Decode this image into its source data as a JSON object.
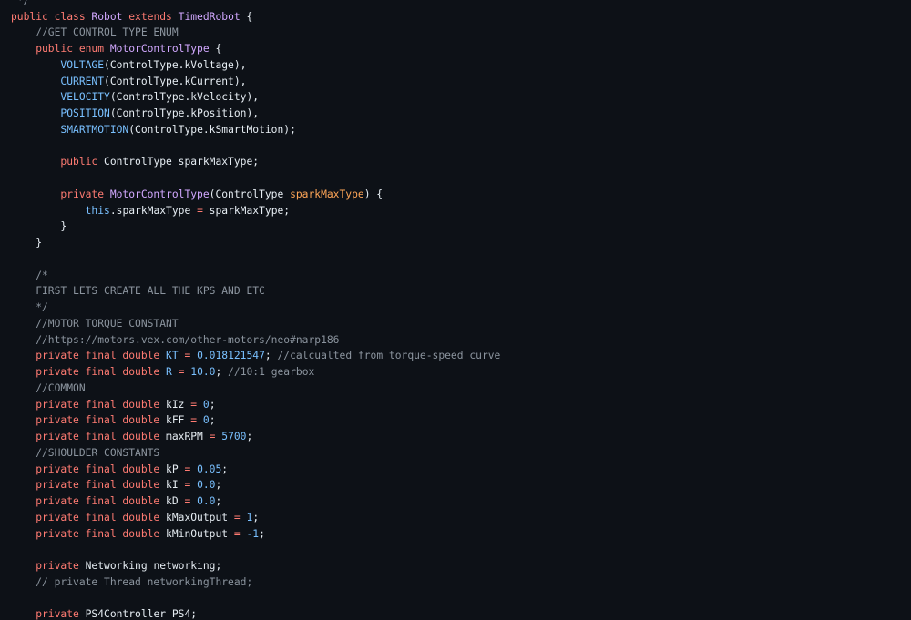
{
  "code": {
    "lines": [
      [
        [
          "cm",
          " */"
        ]
      ],
      [
        [
          "kw",
          "public class "
        ],
        [
          "ty",
          "Robot"
        ],
        [
          "kw",
          " extends "
        ],
        [
          "ty",
          "TimedRobot"
        ],
        [
          "tx",
          " {"
        ]
      ],
      [
        [
          "cm",
          "    //GET CONTROL TYPE ENUM"
        ]
      ],
      [
        [
          "kw",
          "    public enum "
        ],
        [
          "ty",
          "MotorControlType"
        ],
        [
          "tx",
          " {"
        ]
      ],
      [
        [
          "tx",
          "        "
        ],
        [
          "cn",
          "VOLTAGE"
        ],
        [
          "tx",
          "(ControlType.kVoltage),"
        ]
      ],
      [
        [
          "tx",
          "        "
        ],
        [
          "cn",
          "CURRENT"
        ],
        [
          "tx",
          "(ControlType.kCurrent),"
        ]
      ],
      [
        [
          "tx",
          "        "
        ],
        [
          "cn",
          "VELOCITY"
        ],
        [
          "tx",
          "(ControlType.kVelocity),"
        ]
      ],
      [
        [
          "tx",
          "        "
        ],
        [
          "cn",
          "POSITION"
        ],
        [
          "tx",
          "(ControlType.kPosition),"
        ]
      ],
      [
        [
          "tx",
          "        "
        ],
        [
          "cn",
          "SMARTMOTION"
        ],
        [
          "tx",
          "(ControlType.kSmartMotion);"
        ]
      ],
      [
        [
          "tx",
          ""
        ]
      ],
      [
        [
          "kw",
          "        public "
        ],
        [
          "tx",
          "ControlType sparkMaxType;"
        ]
      ],
      [
        [
          "tx",
          ""
        ]
      ],
      [
        [
          "kw",
          "        private "
        ],
        [
          "ty",
          "MotorControlType"
        ],
        [
          "tx",
          "(ControlType "
        ],
        [
          "pa",
          "sparkMaxType"
        ],
        [
          "tx",
          ") {"
        ]
      ],
      [
        [
          "tx",
          "            "
        ],
        [
          "cn",
          "this"
        ],
        [
          "tx",
          ".sparkMaxType "
        ],
        [
          "kw",
          "="
        ],
        [
          "tx",
          " sparkMaxType;"
        ]
      ],
      [
        [
          "tx",
          "        }"
        ]
      ],
      [
        [
          "tx",
          "    }"
        ]
      ],
      [
        [
          "tx",
          ""
        ]
      ],
      [
        [
          "cm",
          "    /*"
        ]
      ],
      [
        [
          "cm",
          "    FIRST LETS CREATE ALL THE KPS AND ETC"
        ]
      ],
      [
        [
          "cm",
          "    */"
        ]
      ],
      [
        [
          "cm",
          "    //MOTOR TORQUE CONSTANT"
        ]
      ],
      [
        [
          "cm",
          "    //https://motors.vex.com/other-motors/neo#narp186"
        ]
      ],
      [
        [
          "kw",
          "    private final double "
        ],
        [
          "cn",
          "KT"
        ],
        [
          "kw",
          " = "
        ],
        [
          "cn",
          "0.018121547"
        ],
        [
          "tx",
          "; "
        ],
        [
          "cm",
          "//calcualted from torque-speed curve"
        ]
      ],
      [
        [
          "kw",
          "    private final double "
        ],
        [
          "cn",
          "R"
        ],
        [
          "kw",
          " = "
        ],
        [
          "cn",
          "10.0"
        ],
        [
          "tx",
          "; "
        ],
        [
          "cm",
          "//10:1 gearbox"
        ]
      ],
      [
        [
          "cm",
          "    //COMMON"
        ]
      ],
      [
        [
          "kw",
          "    private final double "
        ],
        [
          "tx",
          "kIz "
        ],
        [
          "kw",
          "="
        ],
        [
          "tx",
          " "
        ],
        [
          "cn",
          "0"
        ],
        [
          "tx",
          ";"
        ]
      ],
      [
        [
          "kw",
          "    private final double "
        ],
        [
          "tx",
          "kFF "
        ],
        [
          "kw",
          "="
        ],
        [
          "tx",
          " "
        ],
        [
          "cn",
          "0"
        ],
        [
          "tx",
          ";"
        ]
      ],
      [
        [
          "kw",
          "    private final double "
        ],
        [
          "tx",
          "maxRPM "
        ],
        [
          "kw",
          "="
        ],
        [
          "tx",
          " "
        ],
        [
          "cn",
          "5700"
        ],
        [
          "tx",
          ";"
        ]
      ],
      [
        [
          "cm",
          "    //SHOULDER CONSTANTS"
        ]
      ],
      [
        [
          "kw",
          "    private final double "
        ],
        [
          "tx",
          "kP "
        ],
        [
          "kw",
          "="
        ],
        [
          "tx",
          " "
        ],
        [
          "cn",
          "0.05"
        ],
        [
          "tx",
          ";"
        ]
      ],
      [
        [
          "kw",
          "    private final double "
        ],
        [
          "tx",
          "kI "
        ],
        [
          "kw",
          "="
        ],
        [
          "tx",
          " "
        ],
        [
          "cn",
          "0.0"
        ],
        [
          "tx",
          ";"
        ]
      ],
      [
        [
          "kw",
          "    private final double "
        ],
        [
          "tx",
          "kD "
        ],
        [
          "kw",
          "="
        ],
        [
          "tx",
          " "
        ],
        [
          "cn",
          "0.0"
        ],
        [
          "tx",
          ";"
        ]
      ],
      [
        [
          "kw",
          "    private final double "
        ],
        [
          "tx",
          "kMaxOutput "
        ],
        [
          "kw",
          "="
        ],
        [
          "tx",
          " "
        ],
        [
          "cn",
          "1"
        ],
        [
          "tx",
          ";"
        ]
      ],
      [
        [
          "kw",
          "    private final double "
        ],
        [
          "tx",
          "kMinOutput "
        ],
        [
          "kw",
          "="
        ],
        [
          "tx",
          " "
        ],
        [
          "cn",
          "-1"
        ],
        [
          "tx",
          ";"
        ]
      ],
      [
        [
          "tx",
          ""
        ]
      ],
      [
        [
          "kw",
          "    private "
        ],
        [
          "tx",
          "Networking networking;"
        ]
      ],
      [
        [
          "cm",
          "    // private Thread networkingThread;"
        ]
      ],
      [
        [
          "tx",
          ""
        ]
      ],
      [
        [
          "kw",
          "    private "
        ],
        [
          "tx",
          "PS4Controller PS4;"
        ]
      ]
    ]
  },
  "colors": {
    "background": "#0d1117",
    "keyword": "#ff7b72",
    "type": "#d2a8ff",
    "comment": "#8b949e",
    "constant": "#79c0ff",
    "parameter": "#ffa657",
    "text": "#e6edf3"
  }
}
